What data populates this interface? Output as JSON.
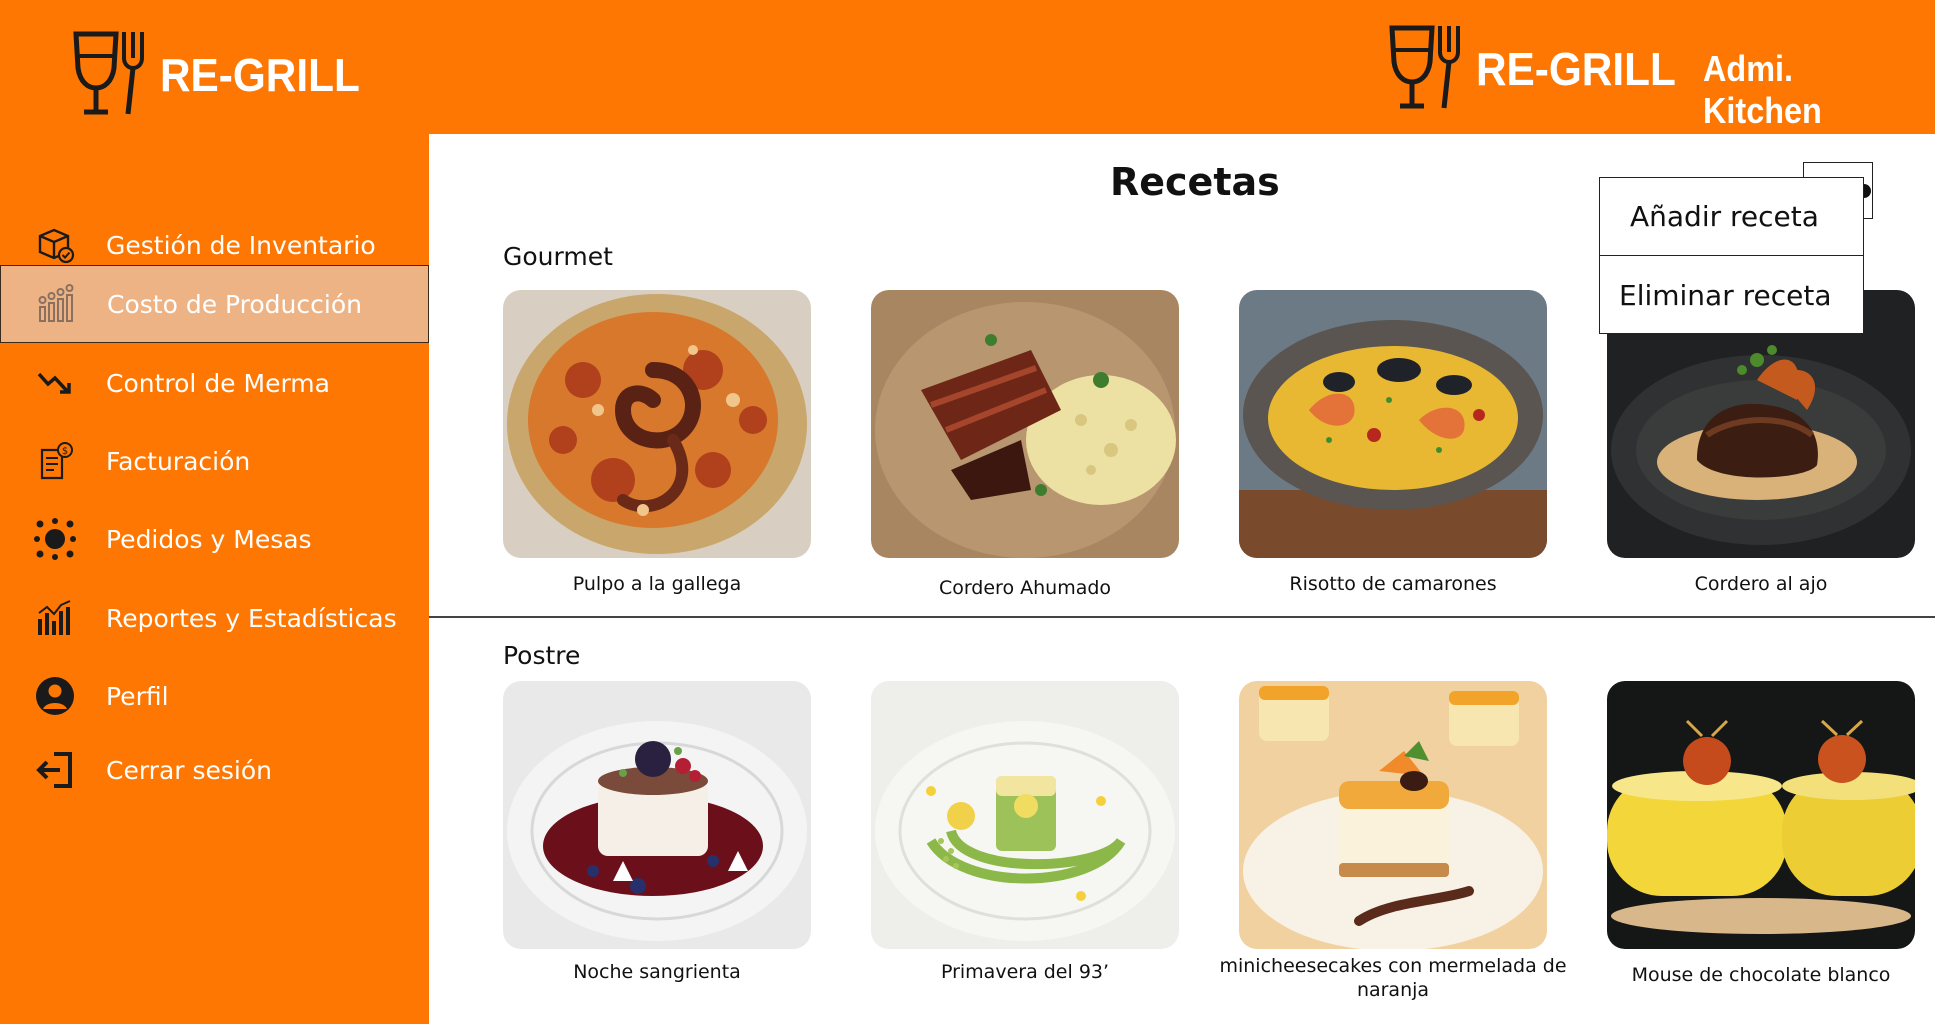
{
  "header": {
    "brand_left": "RE-GRILL",
    "brand_right": "RE-GRILL",
    "user_label": "Admi. Kitchen",
    "accent_color": "#FF7703"
  },
  "sidebar": {
    "items": [
      {
        "label": "Gestión de Inventario",
        "icon": "inventory-box-icon"
      },
      {
        "label": "Costo de Producción",
        "icon": "production-cost-icon",
        "active": true
      },
      {
        "label": "Control de Merma",
        "icon": "trend-down-icon"
      },
      {
        "label": "Facturación",
        "icon": "invoice-icon"
      },
      {
        "label": "Pedidos y Mesas",
        "icon": "table-orders-icon"
      },
      {
        "label": "Reportes y Estadísticas",
        "icon": "stats-chart-icon"
      },
      {
        "label": "Perfil",
        "icon": "user-icon"
      },
      {
        "label": "Cerrar sesión",
        "icon": "logout-icon"
      }
    ],
    "active_color": "#EEB385"
  },
  "main": {
    "title": "Recetas",
    "sections": [
      {
        "title": "Gourmet",
        "recipes": [
          {
            "name": "Pulpo a la gallega",
            "photo": "octopus-dish-photo"
          },
          {
            "name": "Cordero Ahumado",
            "photo": "smoked-lamb-photo"
          },
          {
            "name": "Risotto de camarones",
            "photo": "shrimp-risotto-photo"
          },
          {
            "name": "Cordero al ajo",
            "photo": "garlic-lamb-photo"
          }
        ]
      },
      {
        "title": "Postre",
        "recipes": [
          {
            "name": "Noche sangrienta",
            "photo": "berry-dessert-photo"
          },
          {
            "name": "Primavera del 93’",
            "photo": "spring-dessert-photo"
          },
          {
            "name": "minicheesecakes con mermelada de naranja",
            "photo": "orange-cheesecake-photo"
          },
          {
            "name": "Mouse de chocolate blanco",
            "photo": "white-chocolate-mousse-photo"
          }
        ]
      }
    ]
  },
  "menu": {
    "items": [
      {
        "label": "Añadir receta"
      },
      {
        "label": "Eliminar receta"
      }
    ]
  }
}
